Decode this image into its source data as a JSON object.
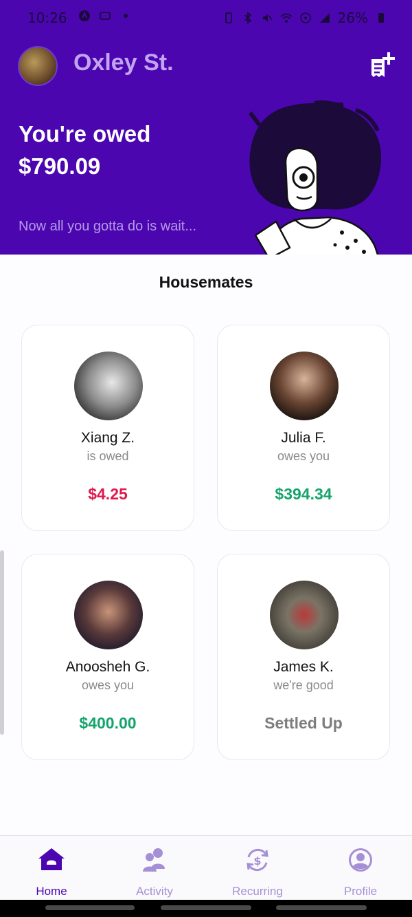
{
  "status_bar": {
    "time": "10:26",
    "battery": "26%"
  },
  "header": {
    "house_name": "Oxley St.",
    "owed_title": "You're owed",
    "owed_amount": "$790.09",
    "tagline": "Now all you gotta do is wait..."
  },
  "section_title": "Housemates",
  "housemates": [
    {
      "name": "Xiang Z.",
      "status": "is owed",
      "amount": "$4.25"
    },
    {
      "name": "Julia F.",
      "status": "owes you",
      "amount": "$394.34"
    },
    {
      "name": "Anoosheh G.",
      "status": "owes you",
      "amount": "$400.00"
    },
    {
      "name": "James K.",
      "status": "we're good",
      "amount": "Settled Up"
    }
  ],
  "nav": [
    {
      "label": "Home",
      "icon": "home-icon",
      "active": true
    },
    {
      "label": "Activity",
      "icon": "people-icon"
    },
    {
      "label": "Recurring",
      "icon": "recurring-dollar-icon"
    },
    {
      "label": "Profile",
      "icon": "profile-icon"
    }
  ],
  "colors": {
    "header_bg": "#4b06b0",
    "accent_light": "#c2a5f2",
    "negative": "#e0184b",
    "positive": "#14a46b",
    "settled": "#7d7d7d"
  }
}
